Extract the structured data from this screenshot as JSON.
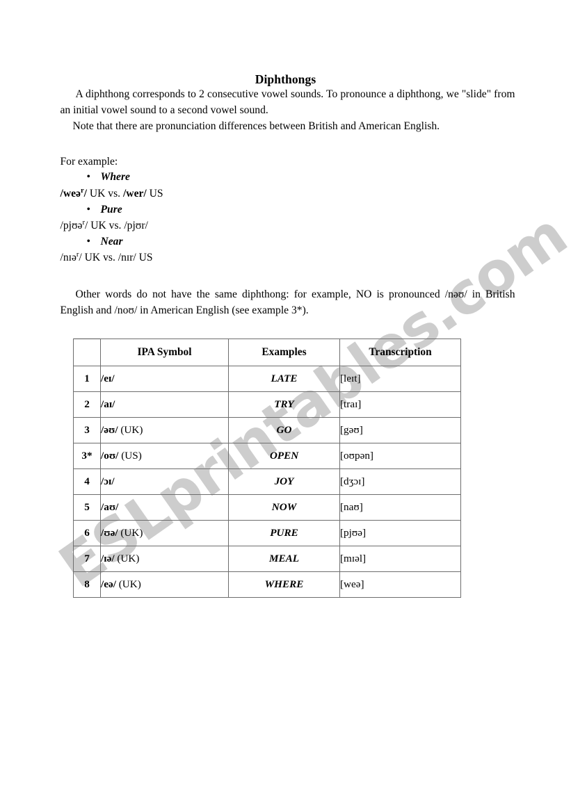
{
  "document": {
    "title": "Diphthongs",
    "paragraphs": [
      "A diphthong corresponds to 2 consecutive vowel sounds. To pronounce a diphthong, we \"slide\" from an initial vowel sound to a second vowel sound.",
      "Note that there are pronunciation differences between British and American English."
    ],
    "for_example_label": "For example:",
    "examples": [
      {
        "bullet": "•",
        "word": "Where",
        "uk_transcription": "/weə",
        "uk_superscript": "r",
        "uk_close": "/",
        "vs_label": " UK vs. ",
        "us_transcription": "/wer/",
        "us_label": "  US"
      },
      {
        "bullet": "•",
        "word": "Pure",
        "uk_transcription": "/pjʊə",
        "uk_superscript": "r",
        "uk_close": "/",
        "vs_label": " UK vs. ",
        "us_transcription": "/pjʊr/",
        "us_label": ""
      },
      {
        "bullet": "•",
        "word": "Near",
        "uk_transcription": "/nɪə",
        "uk_superscript": "r",
        "uk_close": "/",
        "vs_label": " UK vs. ",
        "us_transcription": "/nɪr/",
        "us_label": " US"
      }
    ],
    "closing_paragraph": "Other words do not have the same diphthong: for example, NO is pronounced /nəʊ/ in British English and /noʊ/ in American English (see example 3*)."
  },
  "table": {
    "headers": [
      "",
      "IPA Symbol",
      "Examples",
      "Transcription"
    ],
    "rows": [
      {
        "num": "1",
        "symbol": "/eɪ/",
        "region": "",
        "example": "LATE",
        "transcription": "[leɪt]"
      },
      {
        "num": "2",
        "symbol": "/aɪ/",
        "region": "",
        "example": "TRY",
        "transcription": "[traɪ]"
      },
      {
        "num": "3",
        "symbol": "/əʊ/",
        "region": " (UK)",
        "example": "GO",
        "transcription": "[gəʊ]"
      },
      {
        "num": "3*",
        "symbol": "/oʊ/",
        "region": " (US)",
        "example": "OPEN",
        "transcription": "[oʊpən]"
      },
      {
        "num": "4",
        "symbol": "/ɔɪ/",
        "region": "",
        "example": "JOY",
        "transcription": "[dʒɔɪ]"
      },
      {
        "num": "5",
        "symbol": "/aʊ/",
        "region": "",
        "example": "NOW",
        "transcription": "[naʊ]"
      },
      {
        "num": "6",
        "symbol": "/ʊə/",
        "region": " (UK)",
        "example": "PURE",
        "transcription": "[pjʊə]"
      },
      {
        "num": "7",
        "symbol": "/ɪə/",
        "region": " (UK)",
        "example": "MEAL",
        "transcription": "[mɪəl]"
      },
      {
        "num": "8",
        "symbol": "/eə/",
        "region": " (UK)",
        "example": "WHERE",
        "transcription": "[weə]"
      }
    ]
  },
  "watermark": {
    "text": "ESLprintables.com",
    "color": "#cdcdcd"
  }
}
